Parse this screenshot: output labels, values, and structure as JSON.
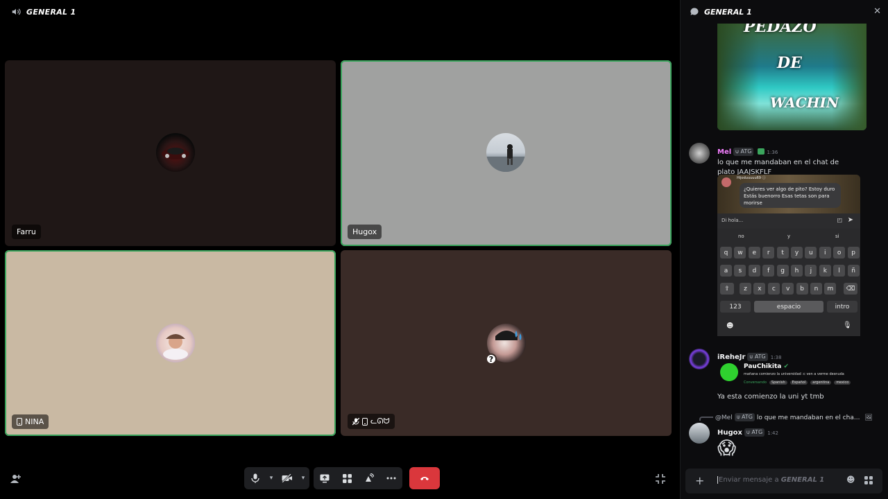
{
  "voice": {
    "channel_title": "GENERAL 1",
    "tiles": [
      {
        "name": "Farru",
        "bg": "#1f1716",
        "speaking": false
      },
      {
        "name": "Hugox",
        "bg": "#a0a1a0",
        "speaking": true
      },
      {
        "name": "NINA",
        "bg": "#c9b9a3",
        "speaking": true
      },
      {
        "name": "ᓚᘏᗢ",
        "bg": "#3a2b27",
        "speaking": false
      }
    ]
  },
  "chat": {
    "title": "GENERAL 1",
    "image_text": [
      "PEDAZO",
      "DE",
      "WACHIN"
    ],
    "messages": [
      {
        "user": "Mel",
        "user_color": "#f47fff",
        "tag": "ATG",
        "time": "1:36",
        "text": "lo que me mandaban en el chat de plato JAAJSKFLF"
      },
      {
        "user": "iReheJr",
        "user_color": "#f2f3f5",
        "tag": "ATG",
        "time": "1:38",
        "text": "Ya esta comienzo la uni yt tmb"
      },
      {
        "user": "Hugox",
        "user_color": "#f2f3f5",
        "tag": "ATG",
        "time": "1:42",
        "text": "😱"
      }
    ],
    "reply": {
      "user": "@Mel",
      "tag": "ATG",
      "text": "lo que me mandaban en el cha..."
    },
    "embed_phone": {
      "sender": "Hijoduuuuu69",
      "message": "¿Quieres ver algo de pito? Estoy duro Estás buenorro Esas tetas son para morirse",
      "input_placeholder": "Di hola...",
      "suggestions": [
        "no",
        "y",
        "si"
      ],
      "row1": [
        "q",
        "w",
        "e",
        "r",
        "t",
        "y",
        "u",
        "i",
        "o",
        "p"
      ],
      "row2": [
        "a",
        "s",
        "d",
        "f",
        "g",
        "h",
        "j",
        "k",
        "l",
        "ñ"
      ],
      "row3": [
        "z",
        "x",
        "c",
        "v",
        "b",
        "n",
        "m"
      ],
      "num_key": "123",
      "space_key": "espacio",
      "enter_key": "intro"
    },
    "embed_profile": {
      "name": "PauChikita",
      "status": "mañana comienzo la universidad :c ven a verme desnuda",
      "state": "Conversando",
      "tags": [
        "Spanish",
        "Español",
        "argentina",
        "mexico"
      ]
    },
    "composer_placeholder_prefix": "Enviar mensaje a ",
    "composer_placeholder_channel": "GENERAL 1"
  },
  "colors": {
    "speaking": "#3ba55d",
    "hangup": "#da373c"
  }
}
